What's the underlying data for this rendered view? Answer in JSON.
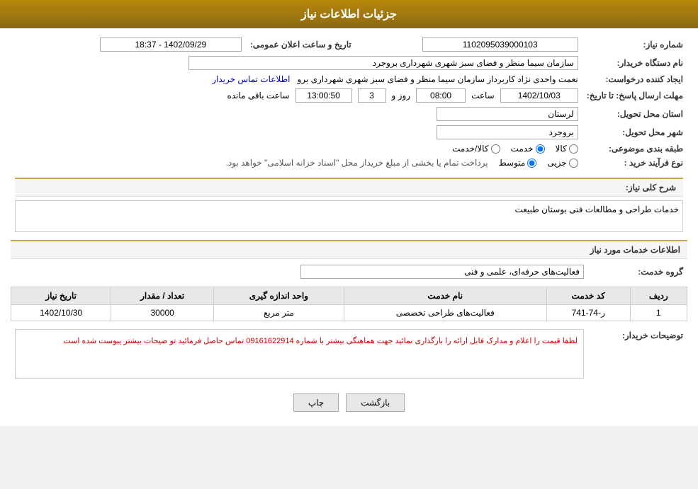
{
  "header": {
    "title": "جزئیات اطلاعات نیاز"
  },
  "fields": {
    "need_number_label": "شماره نیاز:",
    "need_number_value": "1102095039000103",
    "buyer_org_label": "نام دستگاه خریدار:",
    "buyer_org_value": "سازمان سیما منظر و فضای سبز شهری شهرداری بروجرد",
    "creator_label": "ایجاد کننده درخواست:",
    "creator_value": "نعمت واحدی نژاد کاربرداز سازمان سیما منظر و فضای سبز شهری شهرداری برو",
    "creator_link": "اطلاعات تماس خریدار",
    "send_deadline_label": "مهلت ارسال پاسخ: تا تاریخ:",
    "pub_date_label": "تاریخ و ساعت اعلان عمومی:",
    "pub_date_value": "1402/09/29 - 18:37",
    "date_value": "1402/10/03",
    "time_value": "08:00",
    "days_value": "3",
    "remaining_value": "13:00:50",
    "province_label": "استان محل تحویل:",
    "province_value": "لرستان",
    "city_label": "شهر محل تحویل:",
    "city_value": "بروجرد",
    "category_label": "طبقه بندی موضوعی:",
    "category_options": [
      "کالا",
      "خدمت",
      "کالا/خدمت"
    ],
    "category_selected": "خدمت",
    "purchase_type_label": "نوع فرآیند خرید :",
    "purchase_types": [
      "جزیی",
      "متوسط"
    ],
    "purchase_note": "پرداخت تمام یا بخشی از مبلغ خریداز محل \"اسناد خزانه اسلامی\" خواهد بود.",
    "need_desc_label": "شرح کلی نیاز:",
    "need_desc_value": "خدمات طراحی و مطالعات فنی بوستان طبیعت",
    "services_header": "اطلاعات خدمات مورد نیاز",
    "service_group_label": "گروه خدمت:",
    "service_group_value": "فعالیت‌های حرفه‌ای، علمی و فنی",
    "table_headers": {
      "row_num": "ردیف",
      "service_code": "کد خدمت",
      "service_name": "نام خدمت",
      "unit": "واحد اندازه گیری",
      "quantity": "تعداد / مقدار",
      "date": "تاریخ نیاز"
    },
    "table_rows": [
      {
        "row_num": "1",
        "service_code": "ر-74-741",
        "service_name": "فعالیت‌های طراحی تخصصی",
        "unit": "متر مربع",
        "quantity": "30000",
        "date": "1402/10/30"
      }
    ],
    "buyer_notes_label": "توضیحات خریدار:",
    "buyer_notes_value": "لطفا قیمت را اعلام و مدارک قابل ارائه را بارگذاری نمائید جهت هماهنگی بیشتر با شماره 09161622914 تماس حاصل فرمائید  تو ضیحات بیشتر پیوست شده است",
    "btn_print": "چاپ",
    "btn_back": "بازگشت"
  }
}
